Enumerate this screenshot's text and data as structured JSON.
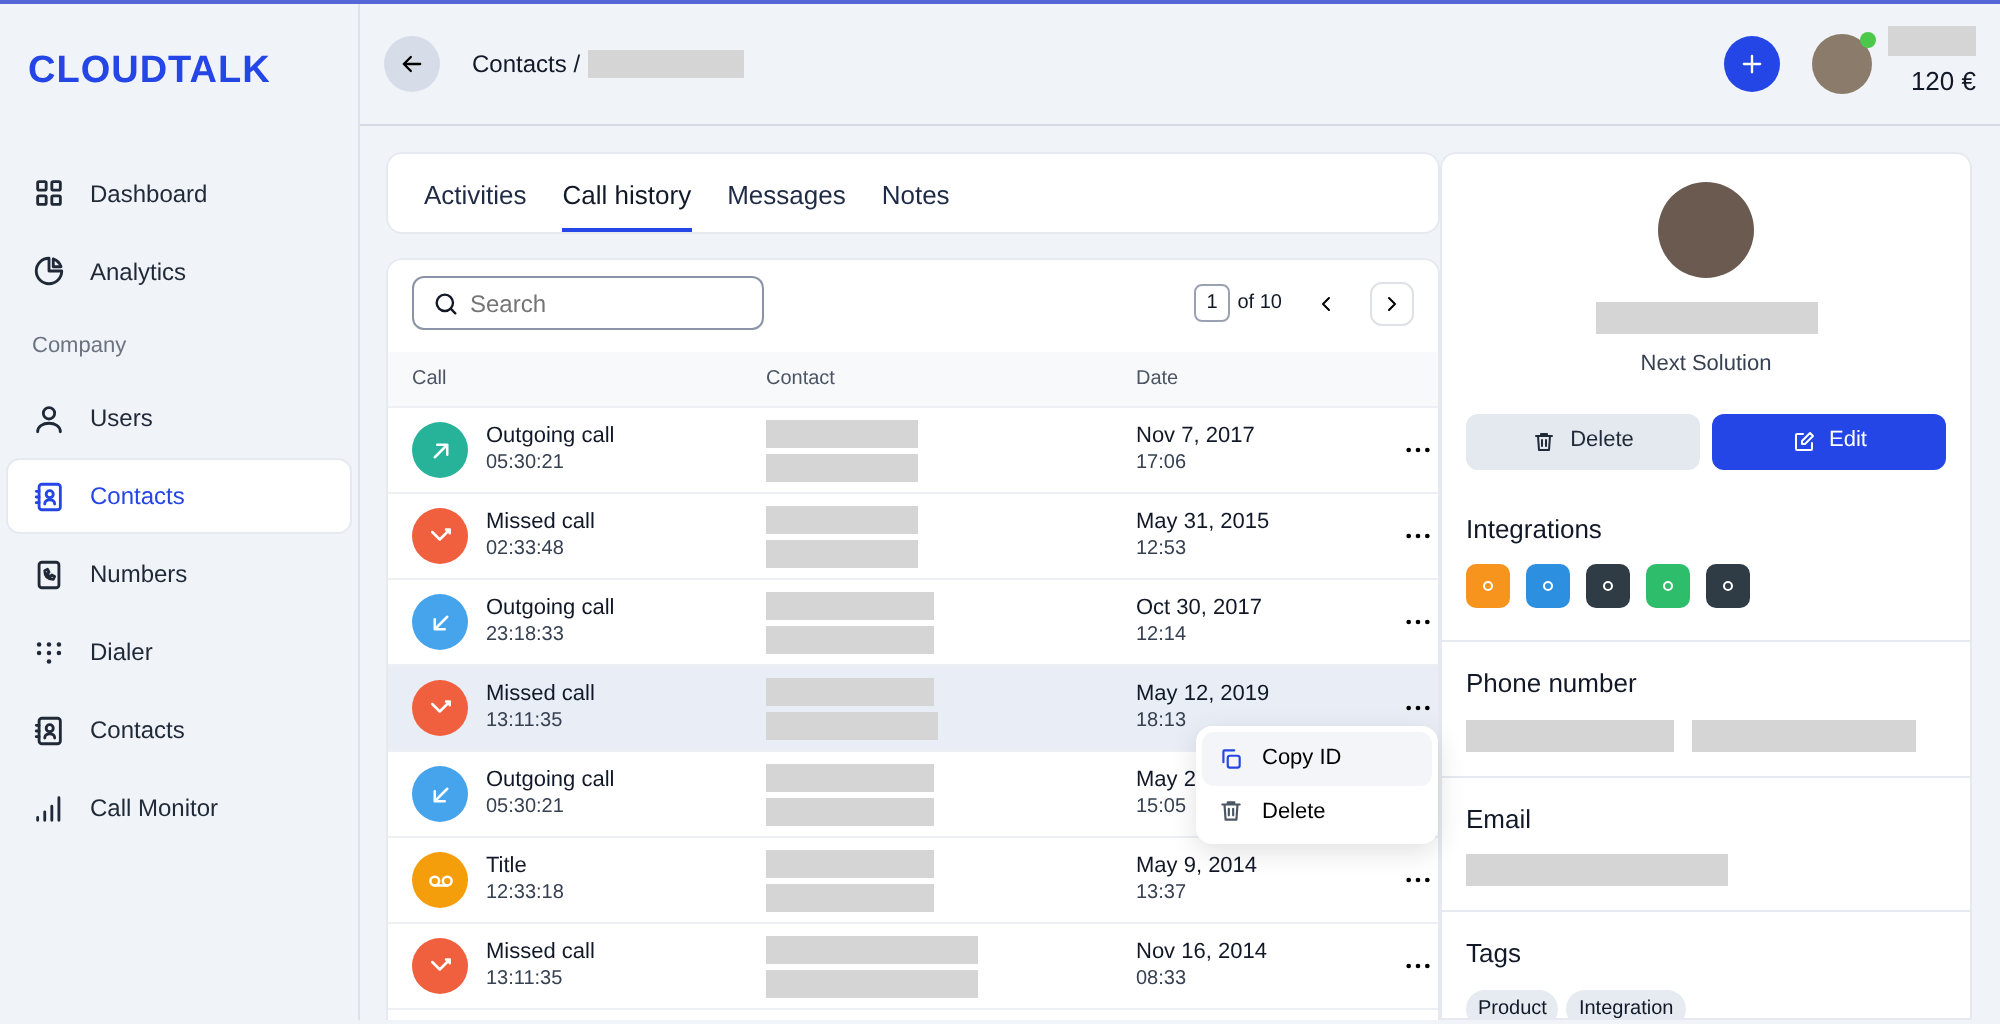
{
  "sidebar": {
    "logo": "CLOUDTALK",
    "items": [
      {
        "kind": "link",
        "label": "Dashboard",
        "selected": false
      },
      {
        "kind": "link",
        "label": "Analytics",
        "selected": false
      },
      {
        "kind": "section",
        "label": "Company"
      },
      {
        "kind": "link",
        "label": "Users",
        "selected": false
      },
      {
        "kind": "link",
        "label": "Contacts",
        "selected": true
      },
      {
        "kind": "link",
        "label": "Numbers",
        "selected": false
      },
      {
        "kind": "link",
        "label": "Dialer",
        "selected": false
      },
      {
        "kind": "link",
        "label": "Contacts",
        "selected": false
      },
      {
        "kind": "link",
        "label": "Call Monitor",
        "selected": false
      }
    ]
  },
  "header": {
    "breadcrumb": "Contacts /",
    "balance": "120 €",
    "online": true
  },
  "tabs": [
    {
      "label": "Activities",
      "selected": false
    },
    {
      "label": "Call history",
      "selected": true
    },
    {
      "label": "Messages",
      "selected": false
    },
    {
      "label": "Notes",
      "selected": false
    }
  ],
  "search": {
    "placeholder": "Search"
  },
  "pagination": {
    "page": "1",
    "total": "of 10"
  },
  "table": {
    "columns": [
      "Call",
      "Contact",
      "Date"
    ],
    "rows": [
      {
        "kind": "outgoing",
        "title": "Outgoing call",
        "duration": "05:30:21",
        "date": "Nov 7, 2017",
        "time": "17:06",
        "highlighted": false
      },
      {
        "kind": "missed",
        "title": "Missed call",
        "duration": "02:33:48",
        "date": "May 31, 2015",
        "time": "12:53",
        "highlighted": false
      },
      {
        "kind": "incoming",
        "title": "Outgoing call",
        "duration": "23:18:33",
        "date": "Oct 30, 2017",
        "time": "12:14",
        "highlighted": false
      },
      {
        "kind": "missed",
        "title": "Missed call",
        "duration": "13:11:35",
        "date": "May 12, 2019",
        "time": "18:13",
        "highlighted": true
      },
      {
        "kind": "incoming",
        "title": "Outgoing call",
        "duration": "05:30:21",
        "date": "May 2",
        "time": "15:05",
        "highlighted": false
      },
      {
        "kind": "voicemail",
        "title": "Title",
        "duration": "12:33:18",
        "date": "May 9, 2014",
        "time": "13:37",
        "highlighted": false
      },
      {
        "kind": "missed",
        "title": "Missed call",
        "duration": "13:11:35",
        "date": "Nov 16, 2014",
        "time": "08:33",
        "highlighted": false
      }
    ]
  },
  "row_menu": {
    "items": [
      {
        "kind": "copy",
        "label": "Copy ID",
        "highlighted": true
      },
      {
        "kind": "delete",
        "label": "Delete",
        "highlighted": false
      }
    ]
  },
  "contact": {
    "company": "Next Solution",
    "buttons": [
      {
        "kind": "delete",
        "label": "Delete"
      },
      {
        "kind": "edit",
        "label": "Edit"
      }
    ],
    "integrations_title": "Integrations",
    "integrations": [
      {
        "color": "#f7941d"
      },
      {
        "color": "#2d8fdf"
      },
      {
        "color": "#2f3b45"
      },
      {
        "color": "#2ebd6b"
      },
      {
        "color": "#2f3b45"
      }
    ],
    "phone_title": "Phone number",
    "email_title": "Email",
    "tags_title": "Tags",
    "tags": [
      "Product",
      "Integration"
    ]
  }
}
